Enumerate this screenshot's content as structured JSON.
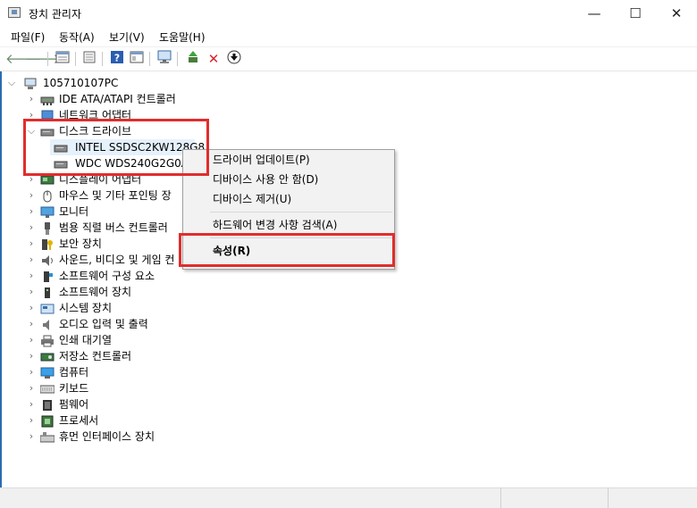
{
  "window": {
    "title": "장치 관리자",
    "minimize": "—",
    "maximize": "☐",
    "close": "✕"
  },
  "menu": [
    "파일(F)",
    "동작(A)",
    "보기(V)",
    "도움말(H)"
  ],
  "toolbar": {
    "back": "🡐",
    "forward": "🡒",
    "help": "?",
    "remove": "✕",
    "update": "⬇"
  },
  "tree": {
    "root": "105710107PC",
    "items": [
      {
        "label": "IDE ATA/ATAPI 컨트롤러",
        "icon": "ide-controller-icon"
      },
      {
        "label": "네트워크 어댑터",
        "icon": "network-adapter-icon"
      },
      {
        "label": "디스크 드라이브",
        "icon": "disk-drive-icon",
        "expanded": true,
        "children": [
          "INTEL SSDSC2KW128G8",
          "WDC WDS240G2G0A"
        ]
      },
      {
        "label": "디스플레이 어댑터",
        "icon": "display-adapter-icon"
      },
      {
        "label": "마우스 및 기타 포인팅 장",
        "icon": "mouse-icon"
      },
      {
        "label": "모니터",
        "icon": "monitor-icon"
      },
      {
        "label": "범용 직렬 버스 컨트롤러",
        "icon": "usb-icon"
      },
      {
        "label": "보안 장치",
        "icon": "security-device-icon"
      },
      {
        "label": "사운드, 비디오 및 게임 컨",
        "icon": "sound-icon"
      },
      {
        "label": "소프트웨어 구성 요소",
        "icon": "software-component-icon"
      },
      {
        "label": "소프트웨어 장치",
        "icon": "software-device-icon"
      },
      {
        "label": "시스템 장치",
        "icon": "system-device-icon"
      },
      {
        "label": "오디오 입력 및 출력",
        "icon": "audio-io-icon"
      },
      {
        "label": "인쇄 대기열",
        "icon": "print-queue-icon"
      },
      {
        "label": "저장소 컨트롤러",
        "icon": "storage-controller-icon"
      },
      {
        "label": "컴퓨터",
        "icon": "computer-icon"
      },
      {
        "label": "키보드",
        "icon": "keyboard-icon"
      },
      {
        "label": "펌웨어",
        "icon": "firmware-icon"
      },
      {
        "label": "프로세서",
        "icon": "processor-icon"
      },
      {
        "label": "휴먼 인터페이스 장치",
        "icon": "hid-icon"
      }
    ]
  },
  "context_menu": {
    "update_driver": "드라이버 업데이트(P)",
    "disable_device": "디바이스 사용 안 함(D)",
    "uninstall_device": "디바이스 제거(U)",
    "scan_hardware": "하드웨어 변경 사항 검색(A)",
    "properties": "속성(R)"
  },
  "colors": {
    "highlight": "#e12d2d",
    "selection": "#e5f1fb"
  }
}
